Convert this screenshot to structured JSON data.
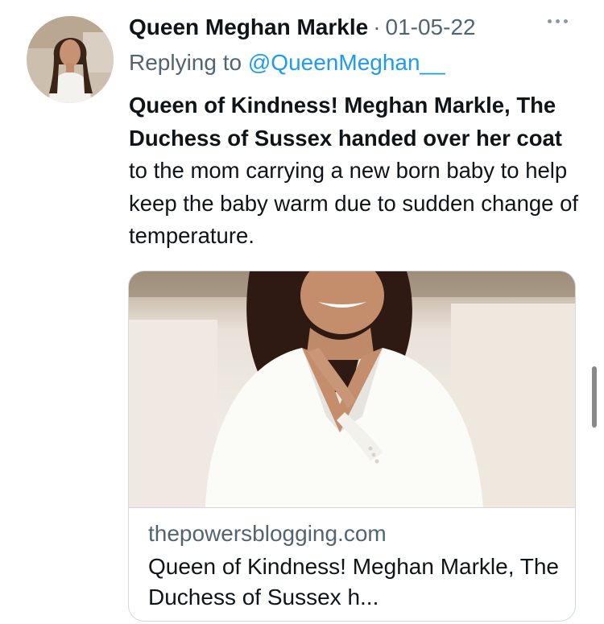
{
  "tweet": {
    "display_name": "Queen Meghan Markle",
    "separator": "·",
    "date": "01-05-22",
    "reply_prefix": "Replying to ",
    "reply_handle": "@QueenMeghan__",
    "text_bold_1": "Queen of Kindness! Meghan Markle, The Duchess of Sussex handed over her coat",
    "text_regular": " to the mom carrying a new born baby to help keep the baby warm due to sudden change of temperature."
  },
  "card": {
    "domain": "thepowersblogging.com",
    "title": "Queen of Kindness! Meghan Markle, The Duchess of Sussex h..."
  },
  "icons": {
    "more": "more-dots-icon",
    "avatar": "profile-photo"
  },
  "colors": {
    "link": "#1d9bf0",
    "secondary_text": "#536471",
    "primary_text": "#0f1419",
    "border": "#cfd9de"
  }
}
